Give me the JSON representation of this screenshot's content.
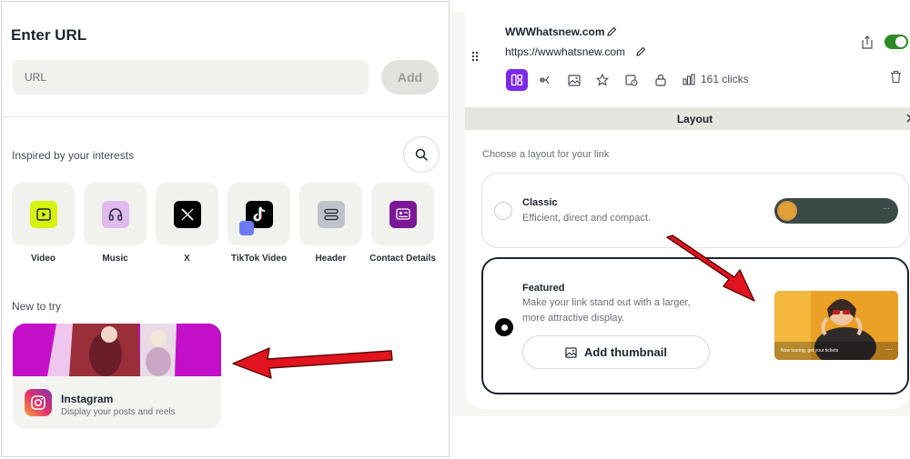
{
  "left_panel": {
    "title": "Enter URL",
    "url_input": {
      "placeholder": "URL",
      "value": ""
    },
    "add_button": "Add",
    "interests_label": "Inspired by your interests",
    "tiles": [
      {
        "label": "Video",
        "icon": "video-icon",
        "color": "#d6f20f"
      },
      {
        "label": "Music",
        "icon": "headphones-icon",
        "color": "#e0b9ee"
      },
      {
        "label": "X",
        "icon": "x-logo-icon",
        "color": "#000000"
      },
      {
        "label": "TikTok Video",
        "icon": "tiktok-icon",
        "color": "#000000"
      },
      {
        "label": "Header",
        "icon": "header-icon",
        "color": "#bfc2c8"
      },
      {
        "label": "Contact Details",
        "icon": "contact-card-icon",
        "color": "#7c1898"
      }
    ],
    "new_to_try_label": "New to try",
    "instagram_card": {
      "title": "Instagram",
      "subtitle": "Display your posts and reels",
      "banner_color": "#c40fc8"
    }
  },
  "right_panel": {
    "link_title": "WWWhatsnew.com",
    "link_url": "https://wwwhatsnew.com",
    "clicks": "161 clicks",
    "toggle_on": true,
    "accent_color": "#7c2ae8",
    "layout_section_title": "Layout",
    "choose_label": "Choose a layout for your link",
    "options": {
      "classic": {
        "name": "Classic",
        "description": "Efficient, direct and compact.",
        "selected": false
      },
      "featured": {
        "name": "Featured",
        "description_line1": "Make your link stand out with a larger,",
        "description_line2": "more attractive display.",
        "selected": true
      }
    },
    "add_thumbnail_button": "Add thumbnail",
    "featured_preview_caption": "Now touring, get your tickets"
  }
}
